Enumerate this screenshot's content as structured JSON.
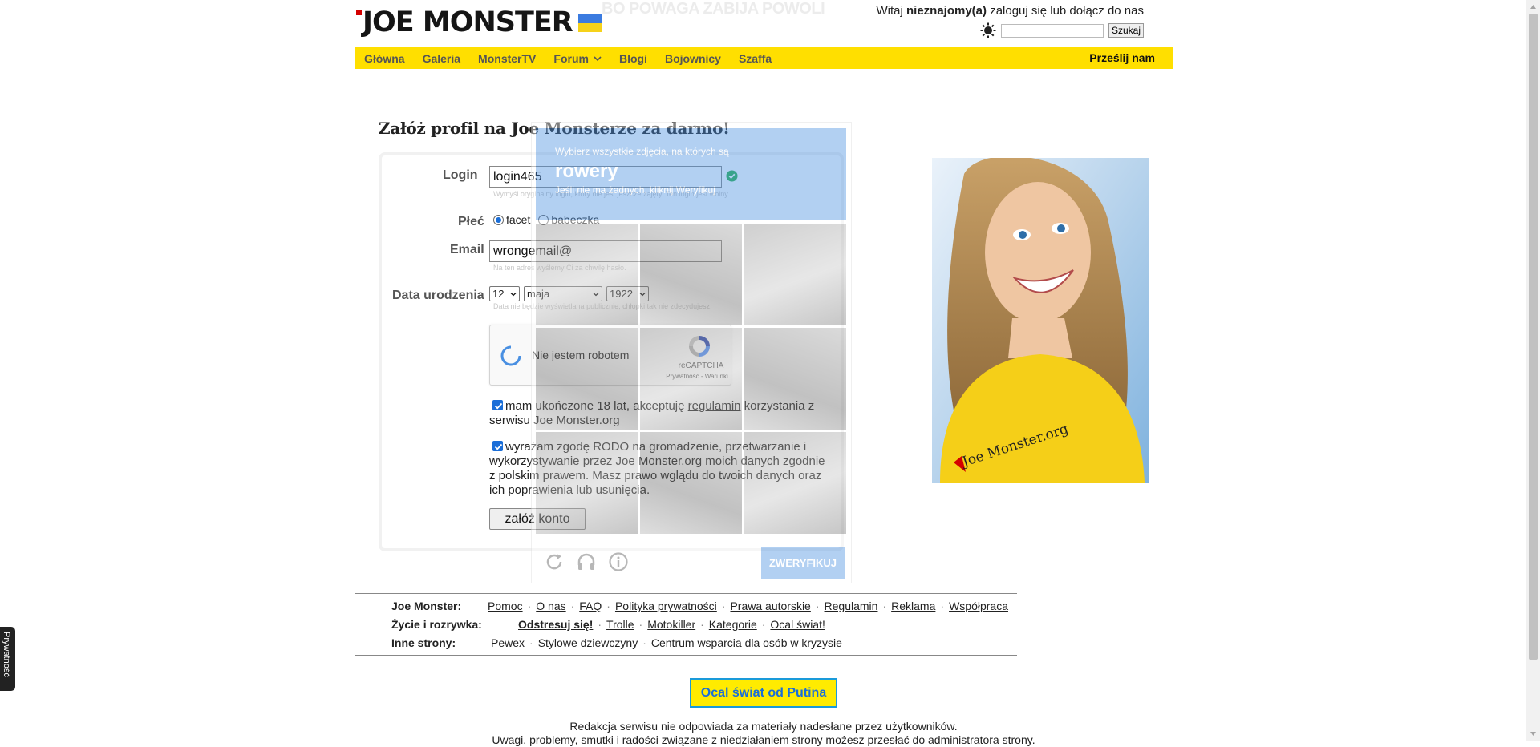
{
  "header": {
    "logo_text": "JOE MONSTER",
    "slogan": "BO POWAGA ZABIJA POWOLI",
    "greeting_prefix": "Witaj ",
    "greeting_user": "nieznajomy(a)",
    "greeting_suffix": " zaloguj się lub dołącz do nas",
    "search_value": "",
    "search_button": "Szukaj"
  },
  "nav": {
    "items": [
      "Główna",
      "Galeria",
      "MonsterTV",
      "Forum",
      "Blogi",
      "Bojownicy",
      "Szaffa"
    ],
    "send": "Prześlij nam"
  },
  "form": {
    "title": "Załóż profil na Joe Monsterze za darmo!",
    "login_label": "Login",
    "login_value": "login465",
    "login_hint": "Wymyśl oryginalny login, który nie jest jeszcze zajęty. Ten login jest wolny.",
    "gender_label": "Płeć",
    "gender_male": "facet",
    "gender_female": "babeczka",
    "email_label": "Email",
    "email_value": "wrongemail@",
    "email_hint": "Na ten adres wyślemy Ci za chwilę hasło.",
    "dob_label": "Data urodzenia",
    "dob_day": "12",
    "dob_month": "maja",
    "dob_year": "1922",
    "dob_hint": "Data nie będzie wyświetlana publicznie, chłopki tak nie zdecydujesz.",
    "captcha_text": "Nie jestem robotem",
    "captcha_brand": "reCAPTCHA",
    "captcha_links": "Prywatność - Warunki",
    "agree_age_1": "mam ukończone 18 lat, akceptuję ",
    "agree_age_link": "regulamin",
    "agree_age_2": " korzystania z serwisu Joe Monster.org",
    "agree_rodo": "wyrażam zgodę RODO na gromadzenie, przetwarzanie i wykorzystywanie przez Joe Monster.org moich danych zgodnie z polskim prawem. Masz prawo wglądu do twoich danych oraz ich poprawienia lub usunięcia.",
    "submit": "załóż konto"
  },
  "challenge": {
    "line1": "Wybierz wszystkie zdjęcia, na których są",
    "keyword": "rowery",
    "line2": "Jeśli nie ma żadnych, kliknij Weryfikuj",
    "verify": "ZWERYFIKUJ"
  },
  "footer": {
    "row1_label": "Joe Monster:",
    "row1_links": [
      "Pomoc",
      "O nas",
      "FAQ",
      "Polityka prywatności",
      "Prawa autorskie",
      "Regulamin",
      "Reklama",
      "Współpraca"
    ],
    "row2_label": "Życie i rozrywka:",
    "row2_links": [
      "Odstresuj się!",
      "Trolle",
      "Motokiller",
      "Kategorie",
      "Ocal świat!"
    ],
    "row3_label": "Inne strony:",
    "row3_links": [
      "Pewex",
      "Stylowe dziewczyny",
      "Centrum wsparcia dla osób w kryzysie"
    ],
    "putin_button": "Ocal świat od Putina",
    "disclaimer_1": "Redakcja serwisu nie odpowiada za materiały nadesłane przez użytkowników.",
    "disclaimer_2": "Uwagi, problemy, smutki i radości związane z niedziałaniem strony możesz przesłać do administratora strony."
  },
  "ad": {
    "shirt_text": "Joe Monster.org"
  },
  "privacy_tab": "Prywatność",
  "colors": {
    "nav_yellow": "#ffdf00",
    "recaptcha_blue": "#4a90e2",
    "putin_border": "#1a9ad9"
  }
}
